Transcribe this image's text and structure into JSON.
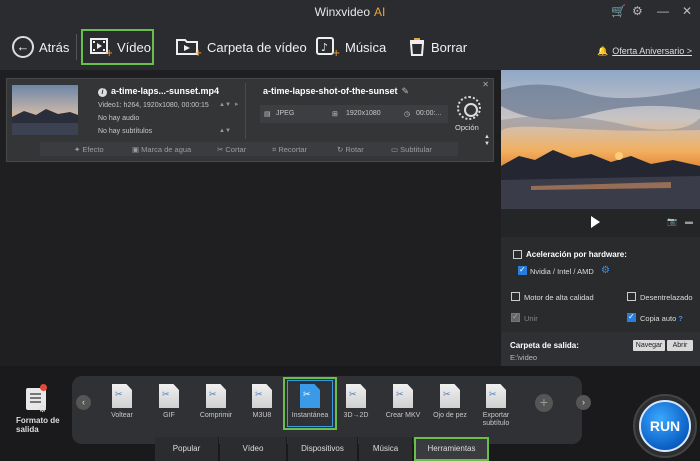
{
  "window": {
    "title": "Winxvideo",
    "title_suffix": "AI"
  },
  "toolbar": {
    "back": "Atrás",
    "video": "Vídeo",
    "folder": "Carpeta de vídeo",
    "music": "Música",
    "delete": "Borrar",
    "promo": "Oferta Aniversario >"
  },
  "task": {
    "source_name": "a-time-laps...-sunset.mp4",
    "video_info": "Video1: h264, 1920x1080, 00:00:15",
    "audio_info": "No hay audio",
    "subtitle_info": "No hay subtítulos",
    "output_name": "a-time-lapse-shot-of-the-sunset",
    "output_format": "JPEG",
    "output_resolution": "1920x1080",
    "output_duration": "00:00:...",
    "option_label": "Opción",
    "edit_buttons": [
      "Efecto",
      "Marca de agua",
      "Cortar",
      "Recortar",
      "Rotar",
      "Subtitular"
    ]
  },
  "settings": {
    "hw_accel_label": "Aceleración por hardware:",
    "hw_vendor_label": "Nvidia / Intel / AMD",
    "high_quality": "Motor de alta calidad",
    "deinterlace": "Desentrelazado",
    "merge": "Unir",
    "autocopy": "Copia auto",
    "help": "?"
  },
  "output": {
    "label": "Carpeta de salida:",
    "path": "E:\\video",
    "browse": "Navegar",
    "open": "Abrir"
  },
  "formats": {
    "left_label_line1": "Formato de",
    "left_label_line2": "salida",
    "items": [
      {
        "label": "Voltear"
      },
      {
        "label": "GIF"
      },
      {
        "label": "Comprimir"
      },
      {
        "label": "M3U8"
      },
      {
        "label": "Instantánea"
      },
      {
        "label": "3D→2D"
      },
      {
        "label": "Crear MKV"
      },
      {
        "label": "Ojo de pez"
      },
      {
        "label": "Exportar subtítulo"
      }
    ],
    "selected_index": 4
  },
  "tabs": [
    "Popular",
    "Vídeo",
    "Dispositivos",
    "Música",
    "Herramientas"
  ],
  "active_tab": "Herramientas",
  "run_label": "RUN",
  "colors": {
    "highlight_green": "#6abf4b",
    "accent_blue": "#2a7ddb",
    "promo_orange": "#f08030"
  }
}
